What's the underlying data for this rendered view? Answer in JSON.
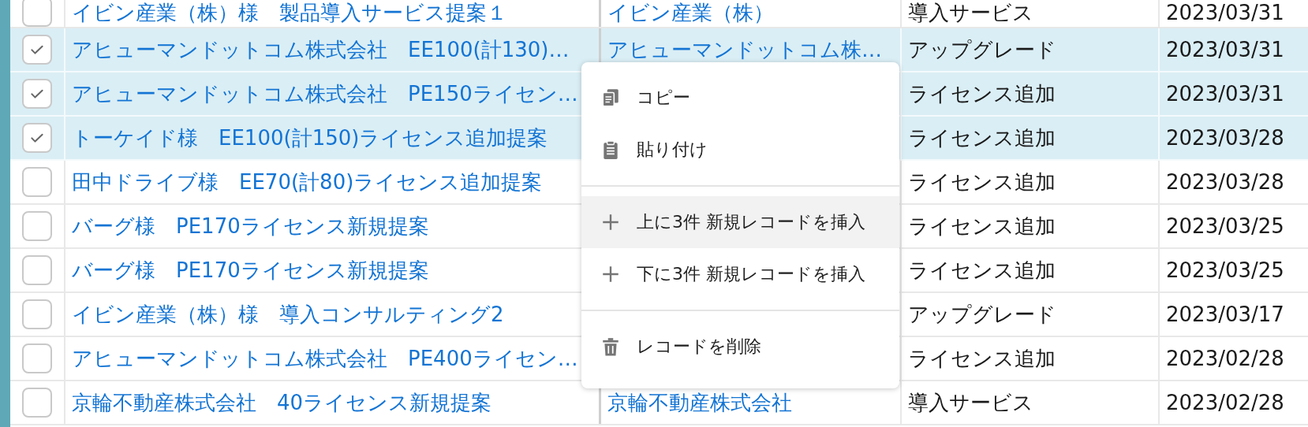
{
  "table": {
    "rows": [
      {
        "checked": false,
        "title": "イビン産業（株）様　製品導入サービス提案１",
        "customer": "イビン産業（株）",
        "type": "導入サービス",
        "date": "2023/03/31"
      },
      {
        "checked": true,
        "title": "アヒューマンドットコム株式会社　EE100(計130)…",
        "customer": "アヒューマンドットコム株…",
        "type": "アップグレード",
        "date": "2023/03/31"
      },
      {
        "checked": true,
        "title": "アヒューマンドットコム株式会社　PE150ライセン…",
        "type": "ライセンス追加",
        "date": "2023/03/31"
      },
      {
        "checked": true,
        "title": "トーケイド様　EE100(計150)ライセンス追加提案",
        "type": "ライセンス追加",
        "date": "2023/03/28"
      },
      {
        "checked": false,
        "title": "田中ドライブ様　EE70(計80)ライセンス追加提案",
        "type": "ライセンス追加",
        "date": "2023/03/28"
      },
      {
        "checked": false,
        "title": "バーグ様　PE170ライセンス新規提案",
        "type": "ライセンス追加",
        "date": "2023/03/25"
      },
      {
        "checked": false,
        "title": "バーグ様　PE170ライセンス新規提案",
        "type": "ライセンス追加",
        "date": "2023/03/25"
      },
      {
        "checked": false,
        "title": "イビン産業（株）様　導入コンサルティング2",
        "type": "アップグレード",
        "date": "2023/03/17"
      },
      {
        "checked": false,
        "title": "アヒューマンドットコム株式会社　PE400ライセン…",
        "type": "ライセンス追加",
        "date": "2023/02/28"
      },
      {
        "checked": false,
        "title": "京輪不動産株式会社　40ライセンス新規提案",
        "customer": "京輪不動産株式会社",
        "type": "導入サービス",
        "date": "2023/02/28"
      }
    ]
  },
  "context_menu": {
    "groups": [
      [
        {
          "label": "コピー",
          "highlighted": false
        },
        {
          "label": "貼り付け",
          "highlighted": false
        }
      ],
      [
        {
          "label": "上に3件 新規レコードを挿入",
          "highlighted": true
        },
        {
          "label": "下に3件 新規レコードを挿入",
          "highlighted": false
        }
      ],
      [
        {
          "label": "レコードを削除",
          "highlighted": false
        }
      ]
    ]
  }
}
